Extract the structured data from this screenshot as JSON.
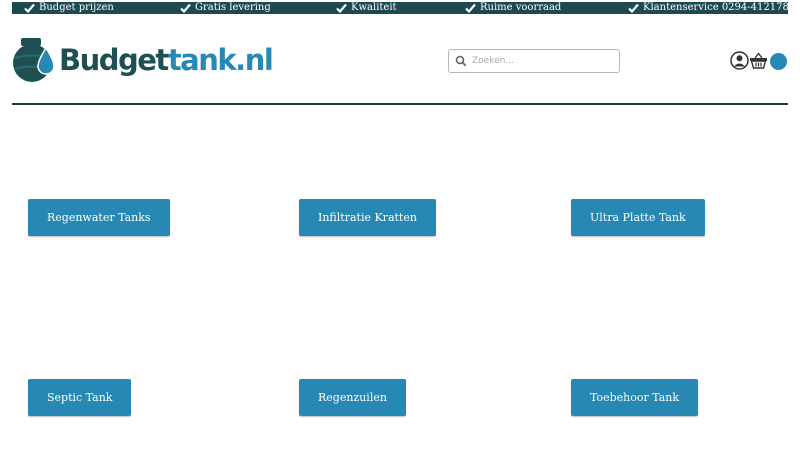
{
  "usp_bar": {
    "items": [
      {
        "label": "Budget prijzen"
      },
      {
        "label": "Gratis levering"
      },
      {
        "label": "Kwaliteit"
      },
      {
        "label": "Ruime voorraad"
      },
      {
        "label": "Klantenservice 0294-412178"
      }
    ],
    "icon": "checkmark-icon",
    "background": "#1d4a4f"
  },
  "header": {
    "logo": {
      "part1": "Budget",
      "part2": "tank.nl"
    },
    "search": {
      "placeholder": "Zoeken...",
      "value": "",
      "icon": "search-icon"
    },
    "account_icon": "user-icon",
    "cart_icon": "basket-icon",
    "cart_count": ""
  },
  "categories": [
    {
      "label": "Regenwater Tanks"
    },
    {
      "label": "Infiltratie Kratten"
    },
    {
      "label": "Ultra Platte Tank"
    },
    {
      "label": "Septic Tank"
    },
    {
      "label": "Regenzuilen"
    },
    {
      "label": "Toebehoor Tank"
    }
  ],
  "colors": {
    "accent": "#2788b4",
    "brand_dark": "#1e4f52",
    "divider": "#1d3a3e"
  }
}
